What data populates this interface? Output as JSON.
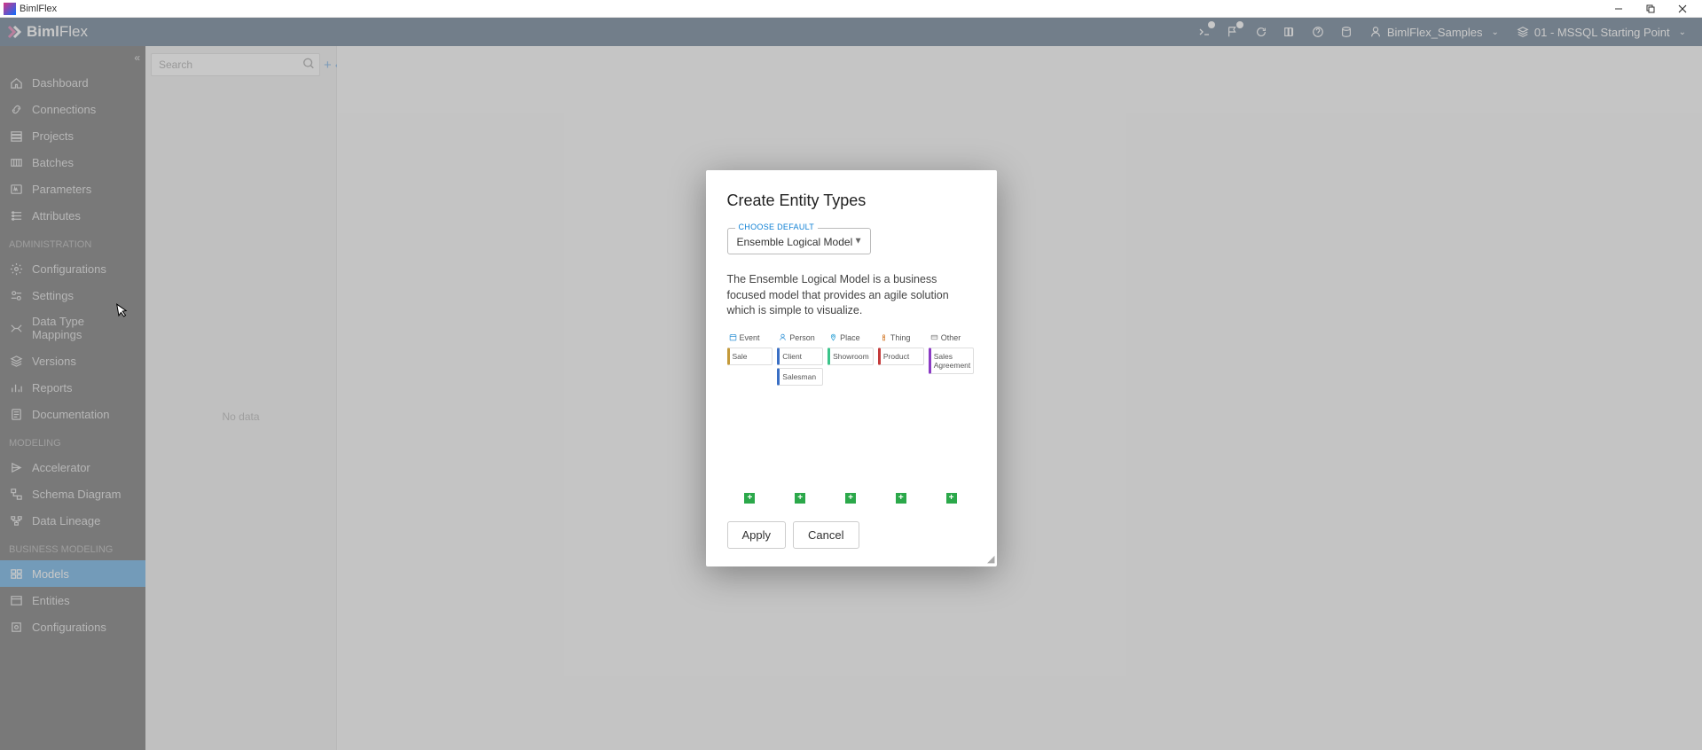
{
  "window": {
    "title": "BimlFlex"
  },
  "brand": {
    "part1": "Biml",
    "part2": "Flex"
  },
  "header": {
    "customer_label": "BimlFlex_Samples",
    "version_label": "01 - MSSQL Starting Point"
  },
  "sidebar": {
    "main": [
      {
        "label": "Dashboard",
        "icon": "home"
      },
      {
        "label": "Connections",
        "icon": "link"
      },
      {
        "label": "Projects",
        "icon": "project"
      },
      {
        "label": "Batches",
        "icon": "batch"
      },
      {
        "label": "Parameters",
        "icon": "param"
      },
      {
        "label": "Attributes",
        "icon": "attr"
      }
    ],
    "admin_section": "ADMINISTRATION",
    "admin": [
      {
        "label": "Configurations",
        "icon": "config"
      },
      {
        "label": "Settings",
        "icon": "settings"
      },
      {
        "label": "Data Type Mappings",
        "icon": "dtm"
      },
      {
        "label": "Versions",
        "icon": "versions"
      },
      {
        "label": "Reports",
        "icon": "reports"
      },
      {
        "label": "Documentation",
        "icon": "docs"
      }
    ],
    "modeling_section": "MODELING",
    "modeling": [
      {
        "label": "Accelerator",
        "icon": "accel"
      },
      {
        "label": "Schema Diagram",
        "icon": "schema"
      },
      {
        "label": "Data Lineage",
        "icon": "lineage"
      }
    ],
    "business_section": "BUSINESS MODELING",
    "business": [
      {
        "label": "Models",
        "icon": "models",
        "active": true
      },
      {
        "label": "Entities",
        "icon": "entities"
      },
      {
        "label": "Configurations",
        "icon": "config2"
      }
    ]
  },
  "list": {
    "search_placeholder": "Search",
    "no_data": "No data"
  },
  "dialog": {
    "title": "Create Entity Types",
    "select_label": "CHOOSE DEFAULT",
    "select_value": "Ensemble Logical Model",
    "description": "The Ensemble Logical Model is a business focused model that provides an agile solution which is simple to visualize.",
    "columns": [
      {
        "name": "Event",
        "cards": [
          "Sale"
        ],
        "colorClass": "kc-event"
      },
      {
        "name": "Person",
        "cards": [
          "Client",
          "Salesman"
        ],
        "colorClass": "kc-person"
      },
      {
        "name": "Place",
        "cards": [
          "Showroom"
        ],
        "colorClass": "kc-place"
      },
      {
        "name": "Thing",
        "cards": [
          "Product"
        ],
        "colorClass": "kc-thing"
      },
      {
        "name": "Other",
        "cards": [
          "Sales Agreement"
        ],
        "colorClass": "kc-other"
      }
    ],
    "apply": "Apply",
    "cancel": "Cancel"
  }
}
